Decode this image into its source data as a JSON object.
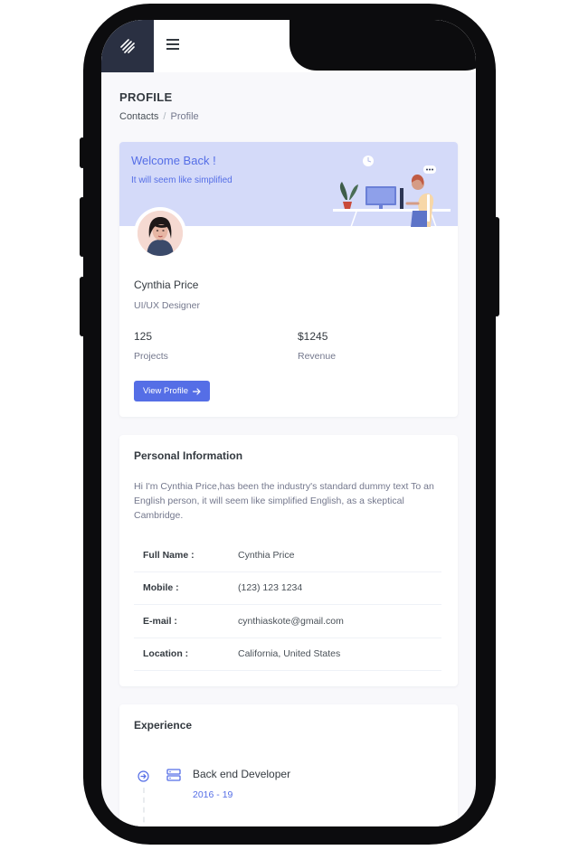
{
  "header": {
    "logo_icon": "logo-stripes-icon",
    "menu_icon": "hamburger-icon",
    "settings_icon": "gear-icon"
  },
  "page": {
    "title": "PROFILE",
    "breadcrumb": [
      "Contacts",
      "Profile"
    ]
  },
  "welcome_card": {
    "heading": "Welcome Back !",
    "subheading": "It will seem like simplified",
    "name": "Cynthia Price",
    "role": "UI/UX Designer",
    "stats": [
      {
        "value": "125",
        "label": "Projects"
      },
      {
        "value": "$1245",
        "label": "Revenue"
      }
    ],
    "button_label": "View Profile"
  },
  "personal_info": {
    "title": "Personal Information",
    "bio": "Hi I'm Cynthia Price,has been the industry's standard dummy text To an English person, it will seem like simplified English, as a skeptical Cambridge.",
    "rows": [
      {
        "key": "Full Name :",
        "value": "Cynthia Price"
      },
      {
        "key": "Mobile :",
        "value": "(123) 123 1234"
      },
      {
        "key": "E-mail :",
        "value": "cynthiaskote@gmail.com"
      },
      {
        "key": "Location :",
        "value": "California, United States"
      }
    ]
  },
  "experience": {
    "title": "Experience",
    "items": [
      {
        "title": "Back end Developer",
        "dates": "2016 - 19"
      }
    ]
  },
  "colors": {
    "primary": "#556ee6",
    "sidebar_dark": "#2a3042",
    "banner": "#d4daf9",
    "badge_red": "#f46a6a"
  }
}
